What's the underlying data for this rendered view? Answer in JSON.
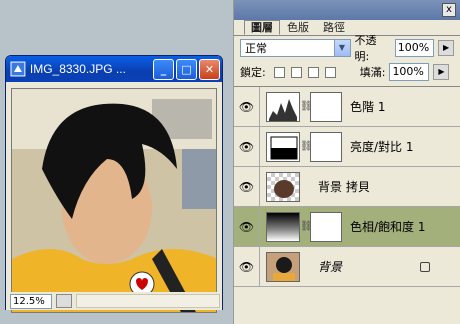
{
  "image_window": {
    "title": "IMG_8330.JPG ...",
    "zoom": "12.5%",
    "buttons": {
      "minimize": "_",
      "maximize": "□",
      "close": "✕"
    }
  },
  "layers_panel": {
    "close": "x",
    "tabs": [
      {
        "label": "圖層",
        "active": true
      },
      {
        "label": "色版",
        "active": false
      },
      {
        "label": "路徑",
        "active": false
      }
    ],
    "blend_mode": "正常",
    "opacity_label": "不透明:",
    "opacity_value": "100%",
    "lock_label": "鎖定:",
    "fill_label": "填滿:",
    "fill_value": "100%",
    "layers": [
      {
        "name": "色階 1",
        "selected": false
      },
      {
        "name": "亮度/對比 1",
        "selected": false
      },
      {
        "name": "背景 拷貝",
        "selected": false
      },
      {
        "name": "色相/飽和度 1",
        "selected": true
      },
      {
        "name": "背景",
        "selected": false
      }
    ]
  },
  "colors": {
    "selected_layer": "#a4b07c",
    "titlebar": "#0a3fb0"
  }
}
